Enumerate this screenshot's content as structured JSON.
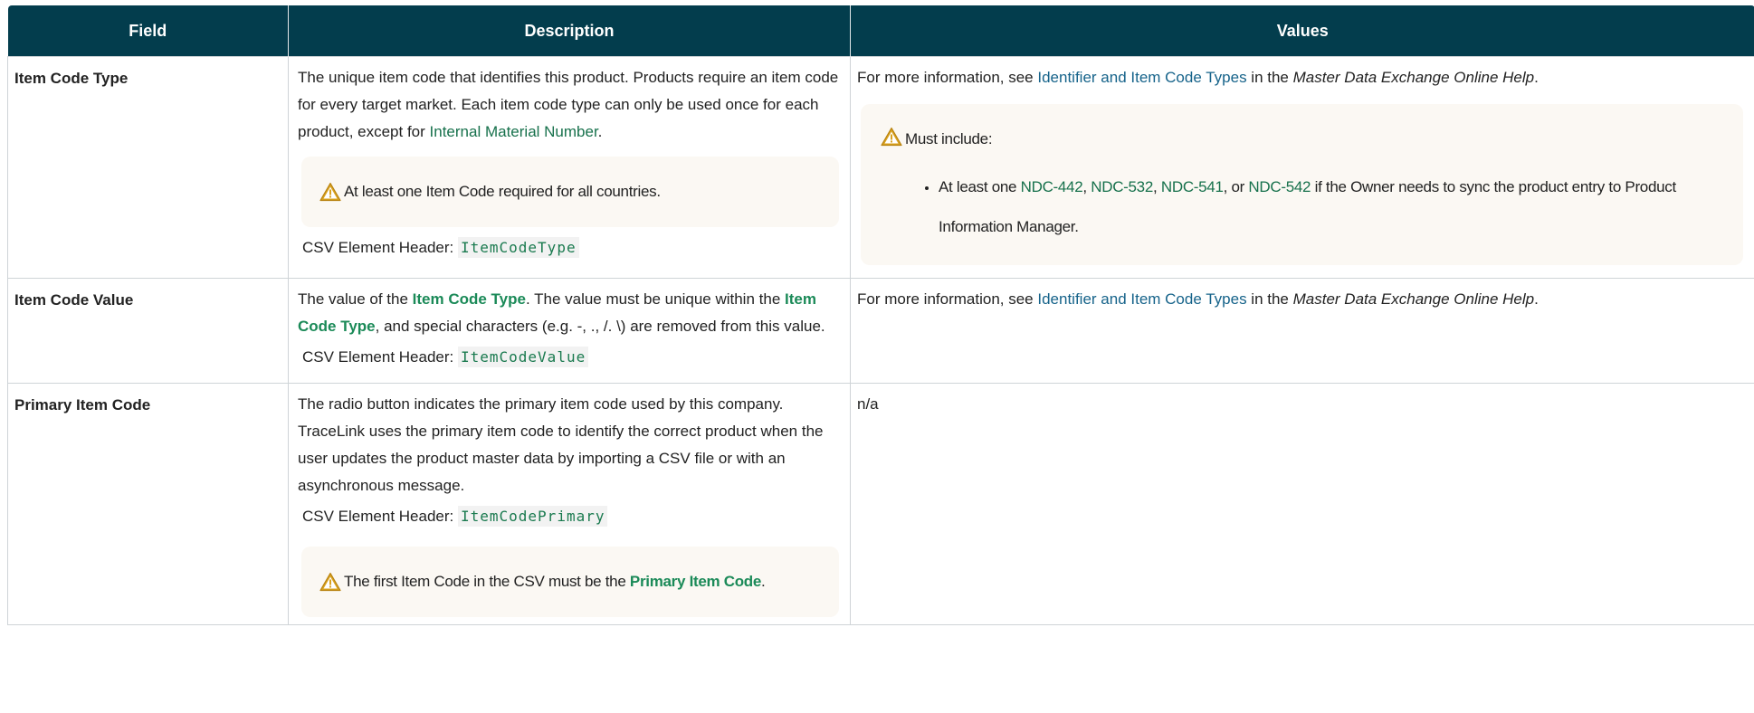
{
  "table": {
    "headers": [
      "Field",
      "Description",
      "Values"
    ],
    "rows": [
      {
        "field": "Item Code Type",
        "desc": {
          "text1": "The unique item code that identifies this product. Products require an item code for every target market. Each item code type can only be used once for each product, except for ",
          "link": "Internal Material Number",
          "text2": ".",
          "note": "At least one Item Code required for all countries.",
          "csv_label": "CSV Element Header:",
          "csv_code": "ItemCodeType"
        },
        "values": {
          "pre": "For more information, see ",
          "link": "Identifier and Item Code Types",
          "mid": " in the ",
          "doc": "Master Data Exchange Online Help",
          "post": ".",
          "note_title": "Must include:",
          "bullet": {
            "t1": "At least one ",
            "l1": "NDC-442",
            "t2": ", ",
            "l2": "NDC-532",
            "t3": ", ",
            "l3": "NDC-541",
            "t4": ", or ",
            "l4": "NDC-542",
            "t5": " if the Owner needs to sync the product entry to Product Information Manager."
          }
        }
      },
      {
        "field": "Item Code Value",
        "desc": {
          "t1": "The value of the ",
          "term1": "Item Code Type",
          "t2": ". The value must be unique within the ",
          "term2": "Item Code Type",
          "t3": ", and special characters (e.g. -, ., /. \\) are removed from this value.",
          "csv_label": "CSV Element Header:",
          "csv_code": "ItemCodeValue"
        },
        "values": {
          "pre": "For more information, see ",
          "link": "Identifier and Item Code Types",
          "mid": " in the ",
          "doc": "Master Data Exchange Online Help",
          "post": "."
        }
      },
      {
        "field": "Primary Item Code",
        "desc": {
          "text": " The radio button indicates the primary item code used by this company. TraceLink uses the primary item code to identify the correct product when the user updates the product master data by importing a CSV file or with an asynchronous message.",
          "csv_label": "CSV Element Header:",
          "csv_code": "ItemCodePrimary",
          "note_t1": "The first Item Code in the CSV must be the ",
          "note_term": "Primary Item Code",
          "note_t2": "."
        },
        "values": {
          "text": "n/a"
        }
      }
    ]
  },
  "colors": {
    "header_bg": "#033d4d",
    "link_green": "#17714c",
    "link_blue": "#16638a",
    "note_bg": "#fbf8f3",
    "warn": "#d9a21f"
  },
  "icons": [
    "warning-icon"
  ]
}
